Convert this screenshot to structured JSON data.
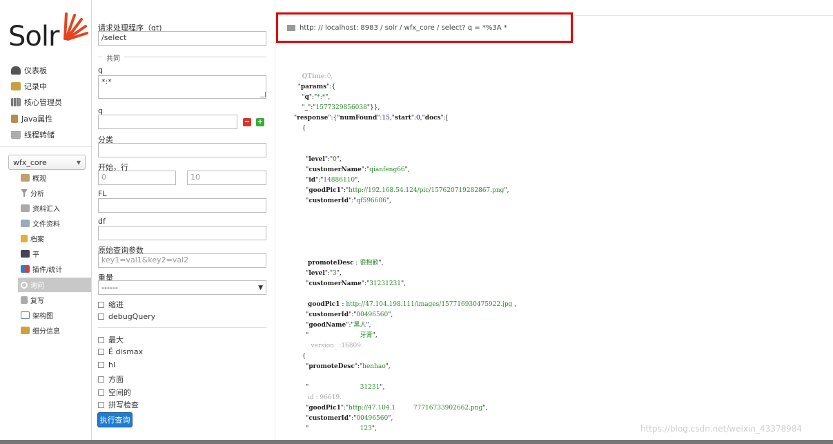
{
  "logo": {
    "text": "Solr"
  },
  "nav": {
    "items": [
      {
        "label": "仪表板",
        "icon": "dashboard-icon",
        "color": "#666"
      },
      {
        "label": "记录中",
        "icon": "logging-icon",
        "color": "#c8a040"
      },
      {
        "label": "核心管理员",
        "icon": "core-admin-icon",
        "color": "#777"
      },
      {
        "label": "Java属性",
        "icon": "java-icon",
        "color": "#b09050"
      },
      {
        "label": "线程转储",
        "icon": "thread-dump-icon",
        "color": "#999"
      }
    ],
    "core_select": "wfx_core",
    "core_items": [
      {
        "label": "概观",
        "icon": "overview-icon",
        "color": "#c0a070"
      },
      {
        "label": "分析",
        "icon": "analysis-icon",
        "color": "#888"
      },
      {
        "label": "资料汇入",
        "icon": "dataimport-icon",
        "color": "#999"
      },
      {
        "label": "文件资料",
        "icon": "documents-icon",
        "color": "#7a9ab0"
      },
      {
        "label": "档案",
        "icon": "files-icon",
        "color": "#e0b040"
      },
      {
        "label": "平",
        "icon": "ping-icon",
        "color": "#556"
      },
      {
        "label": "插件/统计",
        "icon": "plugins-icon",
        "color": "#3a7ac0"
      },
      {
        "label": "询问",
        "icon": "query-icon",
        "color": "#ffffff"
      },
      {
        "label": "复写",
        "icon": "replication-icon",
        "color": "#777"
      },
      {
        "label": "架构图",
        "icon": "schema-icon",
        "color": "#5a80a0"
      },
      {
        "label": "细分信息",
        "icon": "segments-icon",
        "color": "#d0a040"
      }
    ]
  },
  "form": {
    "qt_label": "请求处理程序（qt)",
    "qt_value": "/select",
    "common_label": "共同",
    "q_label": "q",
    "q_value": "*:*",
    "fq_label": "q",
    "fq_value": "",
    "sort_label": "分类",
    "sort_value": "",
    "start_rows_label": "开始，行",
    "start_value": "0",
    "rows_value": "10",
    "fl_label": "FL",
    "fl_value": "",
    "df_label": "df",
    "df_value": "",
    "raw_label": "原始查询参数",
    "raw_placeholder": "key1=val1&key2=val2",
    "wt_label": "重量",
    "wt_value": "------",
    "indent_label": "缩进",
    "debug_label": "debugQuery",
    "checks": [
      "最大",
      "Ë dismax",
      "hl",
      "方面",
      "空间的",
      "拼写检查"
    ],
    "execute_label": "执行查询"
  },
  "result": {
    "url": "http: // localhost: 8983 / solr / wfx_core / select? q = *%3A *",
    "watermark": "https://blog.csdn.net/weixin_43378984"
  },
  "colors": {
    "accent": "#1f7bd2",
    "highlight": "#e00000",
    "active_nav": "#c8c8c8"
  }
}
